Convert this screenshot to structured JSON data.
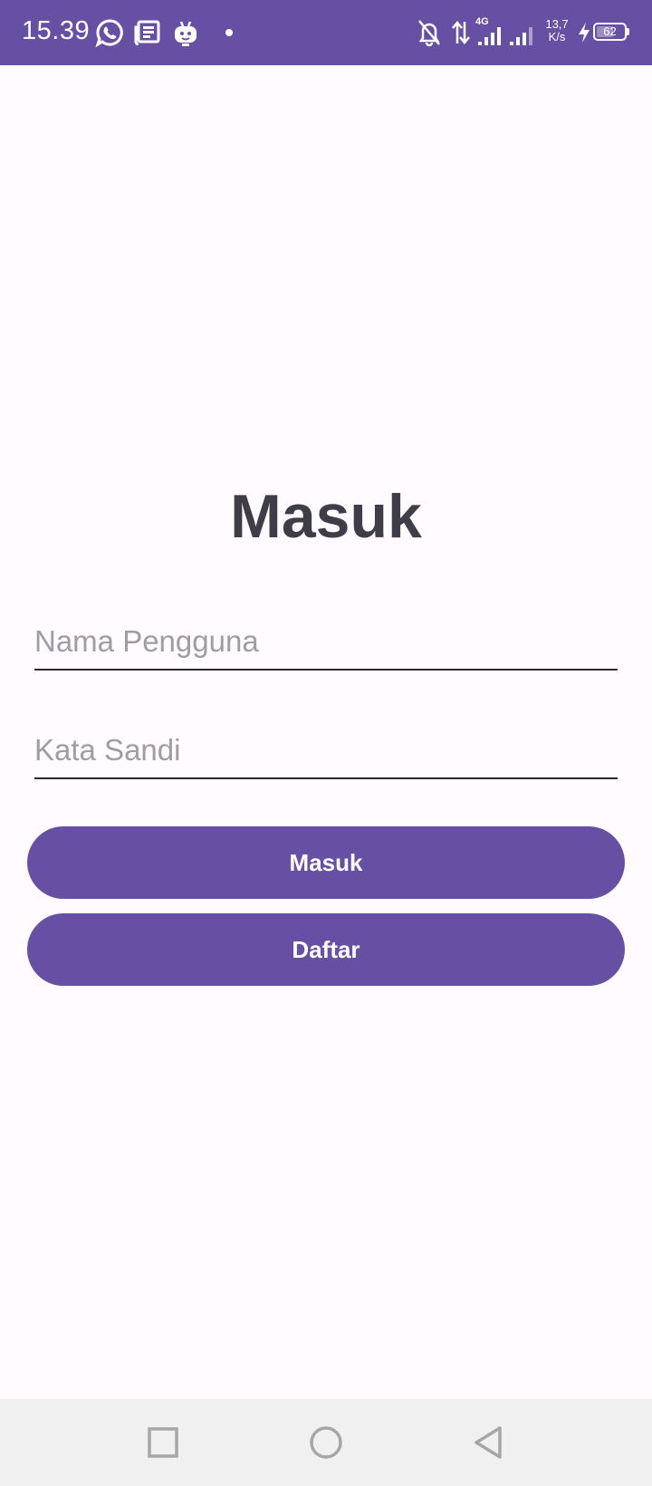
{
  "status_bar": {
    "time": "15.39",
    "network_type": "4G",
    "speed_value": "13,7",
    "speed_unit": "K/s",
    "battery_level": "62",
    "battery_fraction": 0.62,
    "icons": [
      "whatsapp-icon",
      "news-icon",
      "bot-icon",
      "dot-icon",
      "bell-off-icon",
      "data-transfer-icon",
      "signal-icon",
      "signal-icon-2",
      "charging-icon",
      "battery-icon"
    ],
    "background_color": "#6750a4"
  },
  "login": {
    "title": "Masuk",
    "username_placeholder": "Nama Pengguna",
    "username_value": "",
    "password_placeholder": "Kata Sandi",
    "password_value": "",
    "login_button_label": "Masuk",
    "register_button_label": "Daftar",
    "accent_color": "#6750a4",
    "title_color": "#3f3d48"
  },
  "nav_bar": {
    "icons": [
      "recents-square-icon",
      "home-circle-icon",
      "back-triangle-icon"
    ]
  }
}
